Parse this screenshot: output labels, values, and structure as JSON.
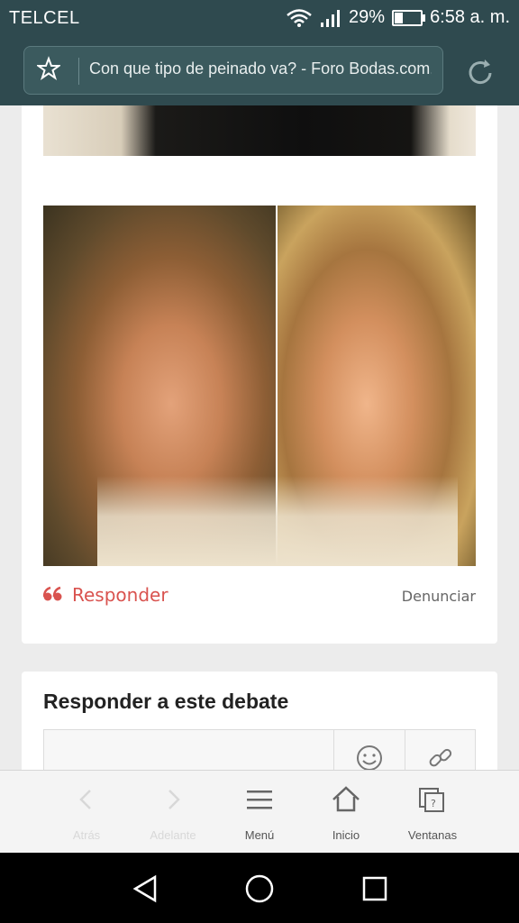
{
  "status": {
    "carrier": "TELCEL",
    "battery": "29%",
    "battery_level": 0.29,
    "time": "6:58 a. m."
  },
  "browser": {
    "url_title": "Con que tipo de peinado va? - Foro Bodas.com.mx"
  },
  "post": {
    "reply_label": "Responder",
    "report_label": "Denunciar"
  },
  "reply_box": {
    "title": "Responder a este debate"
  },
  "toolbar": {
    "back": "Atrás",
    "forward": "Adelante",
    "menu": "Menú",
    "home": "Inicio",
    "windows": "Ventanas"
  },
  "colors": {
    "status_bg": "#2f4a4f",
    "accent_red": "#d9534f"
  }
}
